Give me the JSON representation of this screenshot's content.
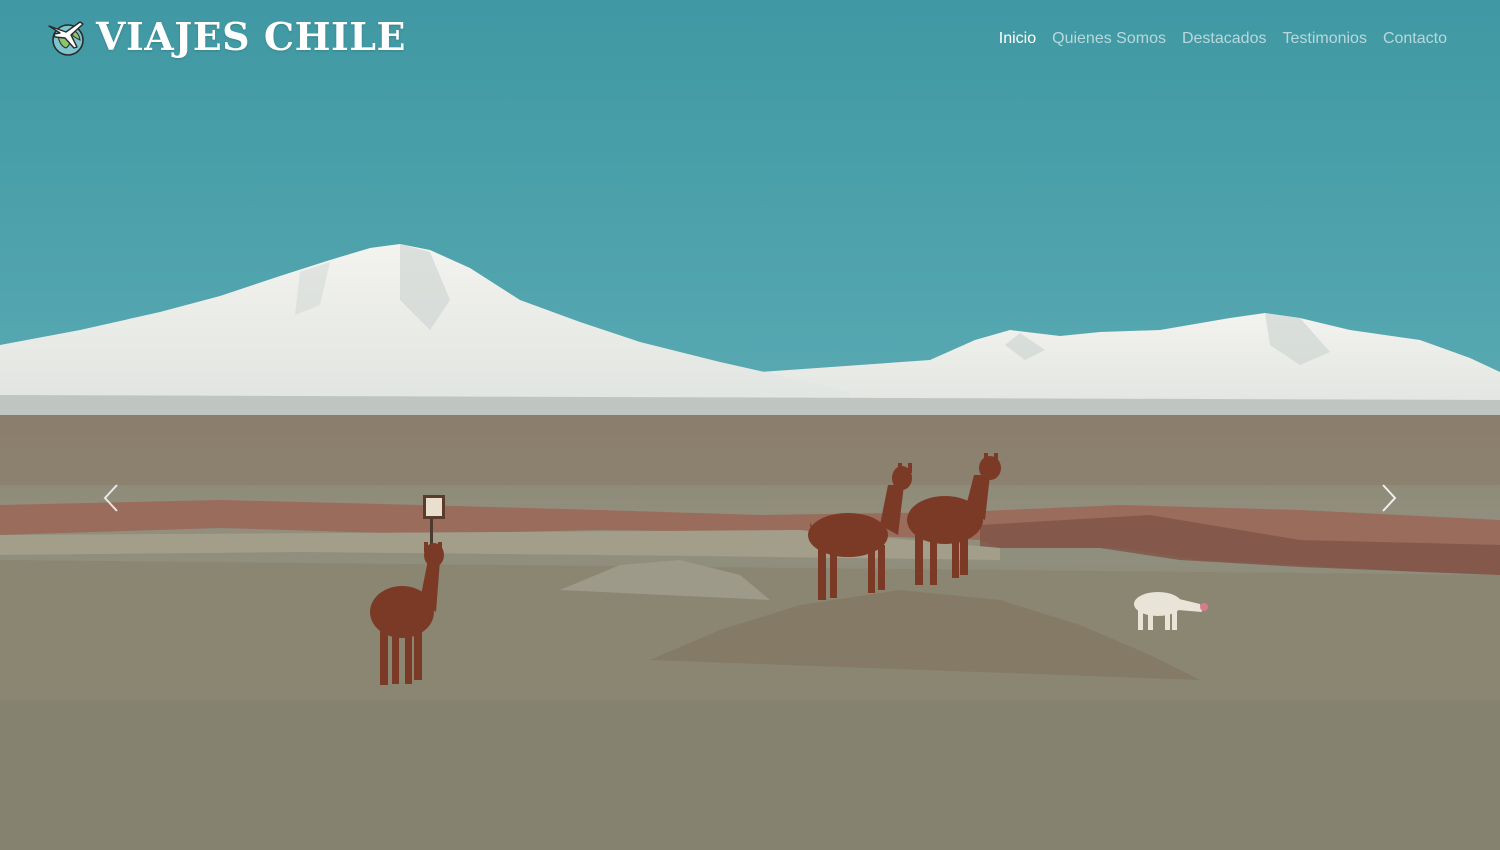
{
  "brand": {
    "title": "VIAJES CHILE",
    "logo_icon": "globe-airplane-icon"
  },
  "nav": {
    "items": [
      {
        "label": "Inicio",
        "active": true
      },
      {
        "label": "Quienes Somos",
        "active": false
      },
      {
        "label": "Destacados",
        "active": false
      },
      {
        "label": "Testimonios",
        "active": false
      },
      {
        "label": "Contacto",
        "active": false
      }
    ]
  },
  "carousel": {
    "prev_icon": "chevron-left-icon",
    "next_icon": "chevron-right-icon",
    "slide_image": "andes-volcano-llamas-photo"
  },
  "colors": {
    "sky": "#4aa0aa",
    "snow": "#eef0ec",
    "ground": "#8e8a76",
    "llama": "#7b3a26",
    "nav_active": "#ffffff",
    "nav_inactive": "rgba(255,255,255,0.62)"
  }
}
